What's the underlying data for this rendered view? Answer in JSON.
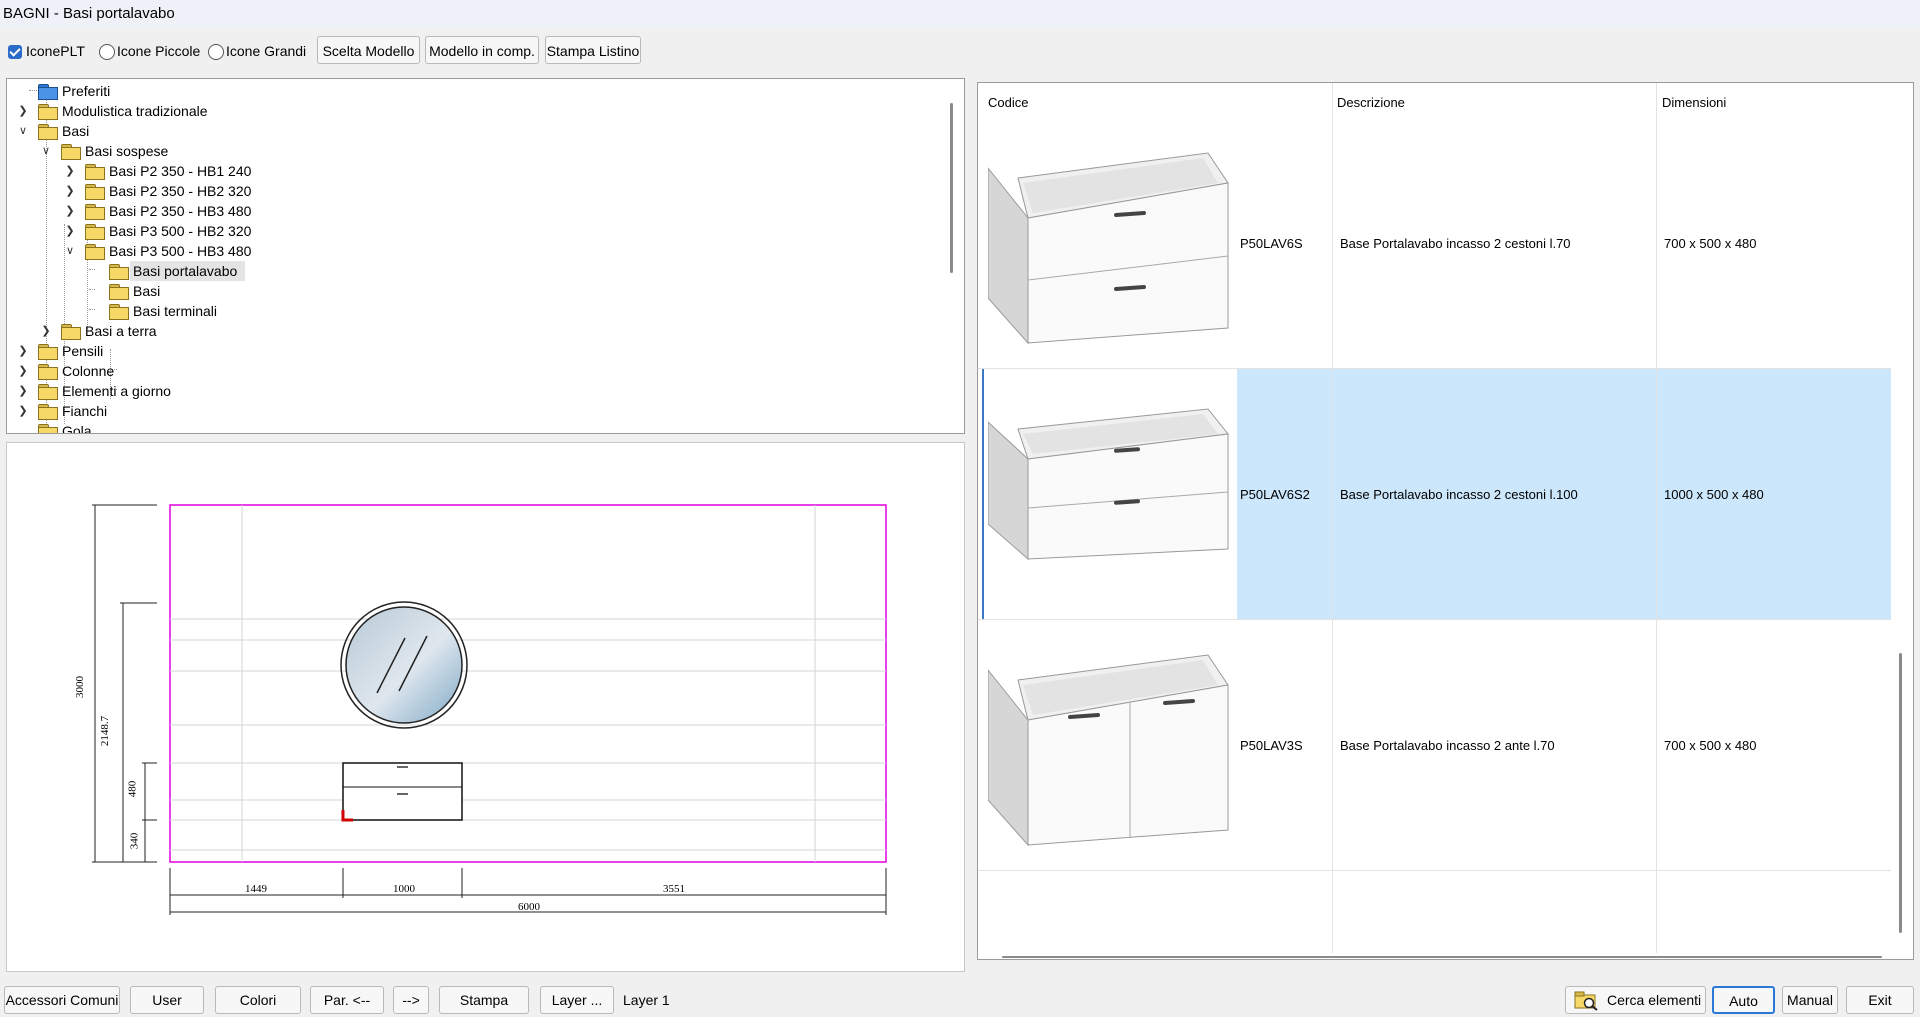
{
  "window": {
    "title": "BAGNI - Basi portalavabo"
  },
  "toolbar": {
    "icone_plt": {
      "label": "IconePLT",
      "checked": true
    },
    "icone_piccole": {
      "label": "Icone Piccole",
      "checked": false
    },
    "icone_grandi": {
      "label": "Icone Grandi",
      "checked": false
    },
    "scelta_modello": "Scelta Modello",
    "modello_in_comp": "Modello in comp.",
    "stampa_listino": "Stampa Listino"
  },
  "tree": {
    "items": [
      {
        "label": "Preferiti",
        "icon": "folder-blue-icon"
      },
      {
        "label": "Modulistica tradizionale",
        "icon": "folder-icon",
        "expander": "collapsed"
      },
      {
        "label": "Basi",
        "icon": "folder-open-icon",
        "expander": "expanded"
      },
      {
        "label": "Basi sospese",
        "icon": "folder-open-icon",
        "expander": "expanded"
      },
      {
        "label": "Basi P2 350 - HB1 240",
        "icon": "folder-icon",
        "expander": "collapsed"
      },
      {
        "label": "Basi P2 350 - HB2 320",
        "icon": "folder-icon",
        "expander": "collapsed"
      },
      {
        "label": "Basi P2 350 - HB3 480",
        "icon": "folder-icon",
        "expander": "collapsed"
      },
      {
        "label": "Basi P3 500 - HB2 320",
        "icon": "folder-icon",
        "expander": "collapsed"
      },
      {
        "label": "Basi P3 500 - HB3 480",
        "icon": "folder-open-icon",
        "expander": "expanded"
      },
      {
        "label": "Basi portalavabo",
        "icon": "folder-icon",
        "selected": true
      },
      {
        "label": "Basi",
        "icon": "folder-icon"
      },
      {
        "label": "Basi terminali",
        "icon": "folder-icon"
      },
      {
        "label": "Basi a terra",
        "icon": "folder-icon",
        "expander": "collapsed"
      },
      {
        "label": "Pensili",
        "icon": "folder-icon",
        "expander": "collapsed"
      },
      {
        "label": "Colonne",
        "icon": "folder-icon",
        "expander": "collapsed"
      },
      {
        "label": "Elementi a giorno",
        "icon": "folder-icon",
        "expander": "collapsed"
      },
      {
        "label": "Fianchi",
        "icon": "folder-icon",
        "expander": "collapsed"
      },
      {
        "label": "Gola",
        "icon": "folder-icon"
      }
    ]
  },
  "drawing": {
    "dims": {
      "height_total": "3000",
      "height_mirror": "2148.7",
      "height_unit": "480",
      "height_base": "340",
      "width_left": "1449",
      "width_unit": "1000",
      "width_right": "3551",
      "width_total": "6000"
    },
    "colors": {
      "wall_border": "#e000e0",
      "insert_mark": "#d00000"
    }
  },
  "grid": {
    "columns": [
      "Codice",
      "Descrizione",
      "Dimensioni"
    ],
    "rows": [
      {
        "code": "P50LAV6S",
        "description": "Base Portalavabo incasso 2 cestoni l.70",
        "dimensions": "700 x 500 x 480",
        "selected": false
      },
      {
        "code": "P50LAV6S2",
        "description": "Base Portalavabo incasso 2 cestoni l.100",
        "dimensions": "1000 x 500 x 480",
        "selected": true
      },
      {
        "code": "P50LAV3S",
        "description": "Base Portalavabo incasso 2 ante l.70",
        "dimensions": "700 x 500 x 480",
        "selected": false
      }
    ],
    "selection_color": "#cce6fb"
  },
  "bottom": {
    "accessori_comuni": "Accessori Comuni",
    "user": "User",
    "colori": "Colori",
    "par_back": "Par. <--",
    "forward": "-->",
    "stampa": "Stampa",
    "layer": "Layer ...",
    "layer_value": "Layer 1",
    "cerca_elementi": "Cerca elementi",
    "auto": "Auto",
    "manual": "Manual",
    "exit": "Exit"
  }
}
